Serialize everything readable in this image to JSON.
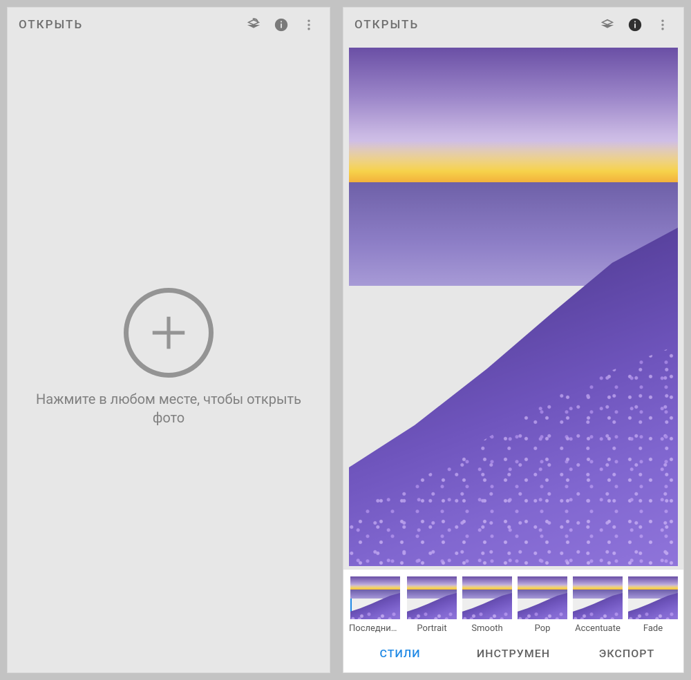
{
  "left": {
    "toolbar": {
      "open": "ОТКРЫТЬ"
    },
    "hint": "Нажмите в любом месте, чтобы открыть фото"
  },
  "right": {
    "toolbar": {
      "open": "ОТКРЫТЬ"
    },
    "styles": [
      {
        "label": "Последние…",
        "selected": true
      },
      {
        "label": "Portrait"
      },
      {
        "label": "Smooth"
      },
      {
        "label": "Pop"
      },
      {
        "label": "Accentuate"
      },
      {
        "label": "Fade"
      }
    ],
    "tabs": {
      "styles": "СТИЛИ",
      "tools": "ИНСТРУМЕН",
      "export": "ЭКСПОРТ",
      "active": "styles"
    }
  }
}
